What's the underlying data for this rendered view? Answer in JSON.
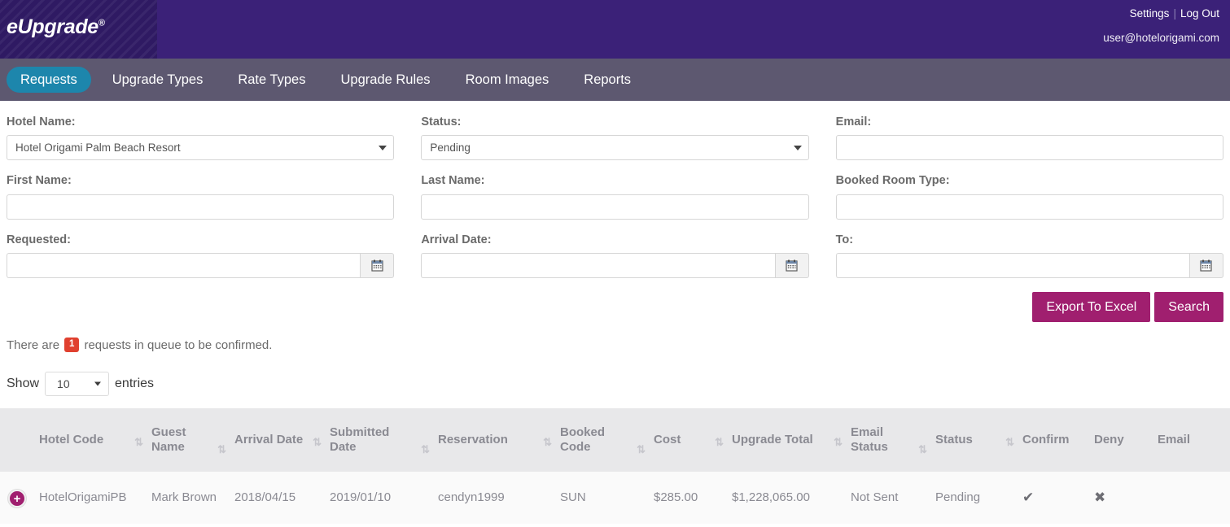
{
  "header": {
    "logo_text": "eUpgrade",
    "logo_superscript": "®",
    "settings_link": "Settings",
    "divider": "|",
    "logout_link": "Log Out",
    "user_email": "user@hotelorigami.com",
    "bg_color": "#3b2178",
    "logo_bg_color": "#2f1a63"
  },
  "nav": {
    "bg_color": "#5d5870",
    "active_color": "#1d86ac",
    "items": [
      {
        "label": "Requests",
        "active": true
      },
      {
        "label": "Upgrade Types",
        "active": false
      },
      {
        "label": "Rate Types",
        "active": false
      },
      {
        "label": "Upgrade Rules",
        "active": false
      },
      {
        "label": "Room Images",
        "active": false
      },
      {
        "label": "Reports",
        "active": false
      }
    ]
  },
  "filters": {
    "hotel_name": {
      "label": "Hotel Name:",
      "value": "Hotel Origami Palm Beach Resort",
      "type": "select"
    },
    "status": {
      "label": "Status:",
      "value": "Pending",
      "type": "select"
    },
    "email": {
      "label": "Email:",
      "value": "",
      "placeholder": "",
      "type": "text"
    },
    "first_name": {
      "label": "First Name:",
      "value": "",
      "placeholder": "",
      "type": "text"
    },
    "last_name": {
      "label": "Last Name:",
      "value": "",
      "placeholder": "",
      "type": "text"
    },
    "booked_room_type": {
      "label": "Booked Room Type:",
      "value": "",
      "placeholder": "",
      "type": "text"
    },
    "requested": {
      "label": "Requested:",
      "value": "",
      "placeholder": "",
      "type": "date",
      "icon": "calendar-icon"
    },
    "arrival_date": {
      "label": "Arrival Date:",
      "value": "",
      "placeholder": "",
      "type": "date",
      "icon": "calendar-icon"
    },
    "to_date": {
      "label": "To:",
      "value": "",
      "placeholder": "",
      "type": "date",
      "icon": "calendar-icon"
    }
  },
  "actions": {
    "export_label": "Export To Excel",
    "search_label": "Search",
    "button_color": "#a01f6f"
  },
  "queue": {
    "prefix": "There are",
    "count": "1",
    "suffix": "requests in queue to be confirmed.",
    "badge_color": "#e0402f"
  },
  "pagination": {
    "show_label": "Show",
    "entries_value": "10",
    "entries_label": "entries"
  },
  "table": {
    "sort_glyph": "⇅",
    "columns": [
      {
        "key": "expand",
        "label": "",
        "sortable": false
      },
      {
        "key": "hotel_code",
        "label": "Hotel Code",
        "sortable": true
      },
      {
        "key": "guest_name",
        "label": "Guest Name",
        "sortable": true
      },
      {
        "key": "arrival_date",
        "label": "Arrival Date",
        "sortable": true
      },
      {
        "key": "submitted_date",
        "label": "Submitted Date",
        "sortable": true
      },
      {
        "key": "reservation",
        "label": "Reservation",
        "sortable": true
      },
      {
        "key": "booked_code",
        "label": "Booked Code",
        "sortable": true
      },
      {
        "key": "cost",
        "label": "Cost",
        "sortable": true
      },
      {
        "key": "upgrade_total",
        "label": "Upgrade Total",
        "sortable": true
      },
      {
        "key": "email_status",
        "label": "Email Status",
        "sortable": true
      },
      {
        "key": "status",
        "label": "Status",
        "sortable": true
      },
      {
        "key": "confirm",
        "label": "Confirm",
        "sortable": false
      },
      {
        "key": "deny",
        "label": "Deny",
        "sortable": false
      },
      {
        "key": "email",
        "label": "Email",
        "sortable": false
      }
    ],
    "rows": [
      {
        "expand": "+",
        "hotel_code": "HotelOrigamiPB",
        "guest_name": "Mark Brown",
        "arrival_date": "2018/04/15",
        "submitted_date": "2019/01/10",
        "reservation": "cendyn1999",
        "booked_code": "SUN",
        "cost": "$285.00",
        "upgrade_total": "$1,228,065.00",
        "email_status": "Not Sent",
        "status": "Pending",
        "confirm_icon": "✔",
        "deny_icon": "✖",
        "email_icon": ""
      }
    ]
  }
}
